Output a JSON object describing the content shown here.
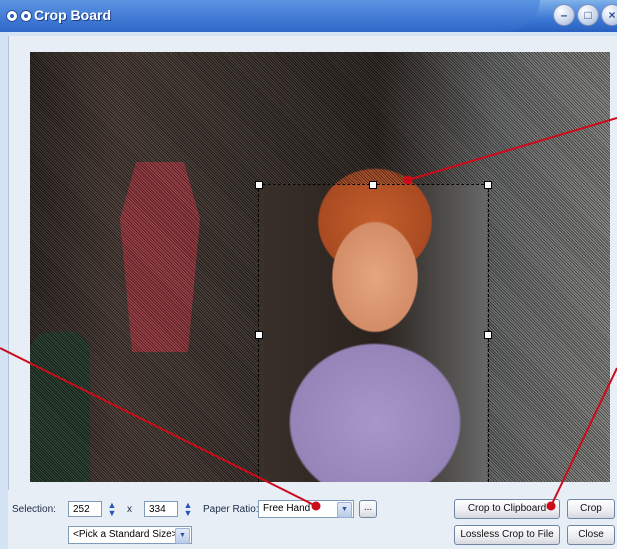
{
  "window": {
    "title": "Crop Board",
    "minimize_glyph": "–",
    "maximize_glyph": "□",
    "close_glyph": "×"
  },
  "toolbar": {
    "selection_label": "Selection:",
    "width_value": "252",
    "times_label": "x",
    "height_value": "334",
    "paper_ratio_label": "Paper Ratio:",
    "paper_ratio_value": "Free Hand",
    "more_button": "...",
    "standard_size_value": "<Pick a Standard Size>",
    "crop_to_clipboard": "Crop to Clipboard",
    "crop": "Crop",
    "lossless_crop_to_file": "Lossless Crop to File",
    "close": "Close"
  },
  "colors": {
    "annotation_red": "#cc0a1a",
    "title_bar_blue": "#2e67c9"
  }
}
